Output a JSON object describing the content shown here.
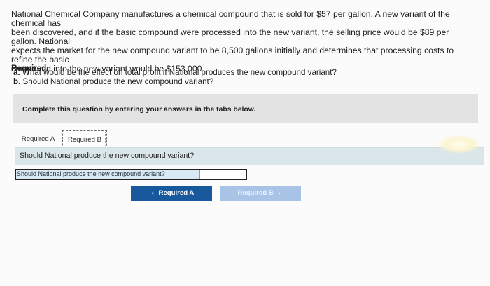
{
  "problem_lines": [
    "National Chemical Company manufactures a chemical compound that is sold for $57 per gallon. A new variant of the chemical has",
    "been discovered, and if the basic compound were processed into the new variant, the selling price would be $89 per gallon. National",
    "expects the market for the new compound variant to be 8,500 gallons initially and determines that processing costs to refine the basic",
    "compound into the new variant would be $153,000."
  ],
  "required": {
    "title": "Required:",
    "items": [
      {
        "prefix": "a.",
        "text": "What would be the effect on total profit if National produces the new compound variant?"
      },
      {
        "prefix": "b.",
        "text": "Should National produce the new compound variant?"
      }
    ]
  },
  "instruction": "Complete this question by entering your answers in the tabs below.",
  "tabs": {
    "a": "Required A",
    "b": "Required B"
  },
  "question": "Should National produce the new compound variant?",
  "answer": {
    "label": "Should National produce the new compound variant?",
    "value": ""
  },
  "nav": {
    "prev_label": "Required A",
    "prev_glyph": "‹",
    "next_label": "Required B",
    "next_glyph": "›"
  },
  "colors": {
    "prev_button": "#18589d",
    "next_button": "#a7c3e6",
    "question_band": "#dbe6ea",
    "instruction_panel": "#e3e3e3"
  }
}
